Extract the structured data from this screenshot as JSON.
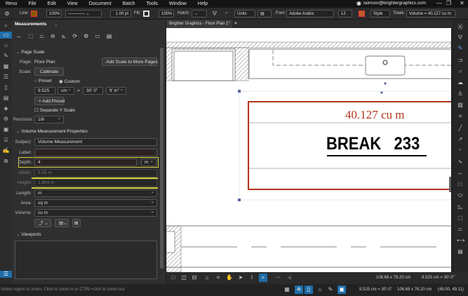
{
  "menu": [
    "Revu",
    "File",
    "Edit",
    "View",
    "Document",
    "Batch",
    "Tools",
    "Window",
    "Help"
  ],
  "user": "taimoor@brightergraphics.com",
  "toolbar": {
    "line_label": "Line:",
    "line_opacity": "100%",
    "line_width": "1.00 pt",
    "fill_label": "Fill:",
    "fill_opacity": "100%",
    "hatch_label": "Hatch:",
    "units": "Units",
    "font_label": "Font:",
    "font": "Adobe Arabic",
    "font_size": "12",
    "style": "Style",
    "totals_label": "Totals:",
    "totals": "Volume = 40.127 cu m",
    "line_color": "#8a5a00",
    "text_color": "#c0392b"
  },
  "panel": {
    "title": "Measurements",
    "page_scale": {
      "header": "Page Scale",
      "page_label": "Page:",
      "page": "Floor Plan",
      "add_scale": "Add Scale to More Pages",
      "scale_label": "Scale:",
      "calibrate": "Calibrate",
      "preset": "Preset",
      "custom": "Custom",
      "value1": "9.525",
      "unit1": "cm",
      "eq": "=",
      "value2": "30' 0\"",
      "unit2": "ft' in\"",
      "add_preset": "+ Add Preset",
      "separate_y": "Separate Y Scale",
      "precision_label": "Precision:",
      "precision": "1/8"
    },
    "volume": {
      "header": "Volume Measurement Properties",
      "subject_label": "Subject:",
      "subject": "Volume Measurement",
      "label_label": "Label:",
      "label": "",
      "depth_label": "Depth:",
      "depth": "4",
      "depth_unit": "m",
      "width_label": "Width:",
      "width": "5.56 m",
      "height_label": "Height:",
      "height": "1.804 m",
      "length_label": "Length:",
      "length": "m",
      "area_label": "Area:",
      "area": "sq m",
      "volume_label": "Volume:",
      "volume": "cu m"
    },
    "viewports": {
      "header": "Viewports"
    }
  },
  "tab": {
    "title": "Brighter Graphics - Floor Plan 1*"
  },
  "canvas": {
    "measurement": "40.127 cu m",
    "room": "BREAK   233",
    "highlight": "#e8d640",
    "measure_color": "#b5361b"
  },
  "canvas_toolbar": {
    "size": "106.68 x 76.20 cm",
    "scale": "9.525 cm = 30'-0\""
  },
  "status": {
    "hint": "Select region to zoom. Click to zoom in or CTRL+click to zoom out",
    "scale": "9.525 cm = 30'-0\"",
    "size": "106.68 x 76.20 cm",
    "coords": "(49.00, 49.11)"
  }
}
